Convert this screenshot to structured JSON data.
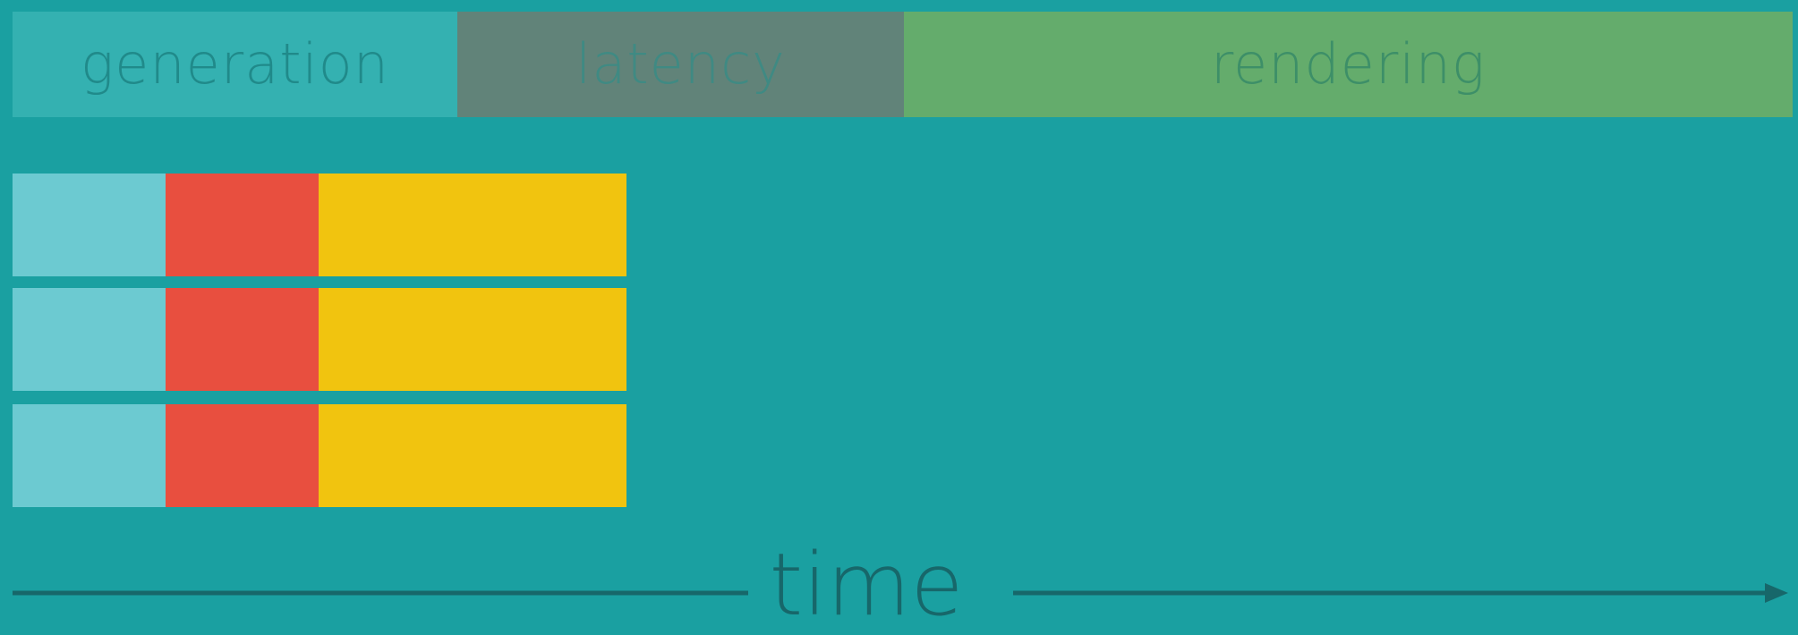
{
  "phases": {
    "generation": {
      "label": "generation",
      "color": "#34b1b1"
    },
    "latency": {
      "label": "latency",
      "color": "#618379"
    },
    "rendering": {
      "label": "rendering",
      "color": "#64ac6c"
    }
  },
  "tracks": [
    {
      "segments": [
        {
          "phase": "generation",
          "color": "#6ccad1"
        },
        {
          "phase": "latency",
          "color": "#e84f3f"
        },
        {
          "phase": "rendering",
          "color": "#f1c40f"
        }
      ]
    },
    {
      "segments": [
        {
          "phase": "generation",
          "color": "#6ccad1"
        },
        {
          "phase": "latency",
          "color": "#e84f3f"
        },
        {
          "phase": "rendering",
          "color": "#f1c40f"
        }
      ]
    },
    {
      "segments": [
        {
          "phase": "generation",
          "color": "#6ccad1"
        },
        {
          "phase": "latency",
          "color": "#e84f3f"
        },
        {
          "phase": "rendering",
          "color": "#f1c40f"
        }
      ]
    }
  ],
  "axis": {
    "label": "time",
    "color": "#17676a"
  },
  "background": "#1aa0a1"
}
